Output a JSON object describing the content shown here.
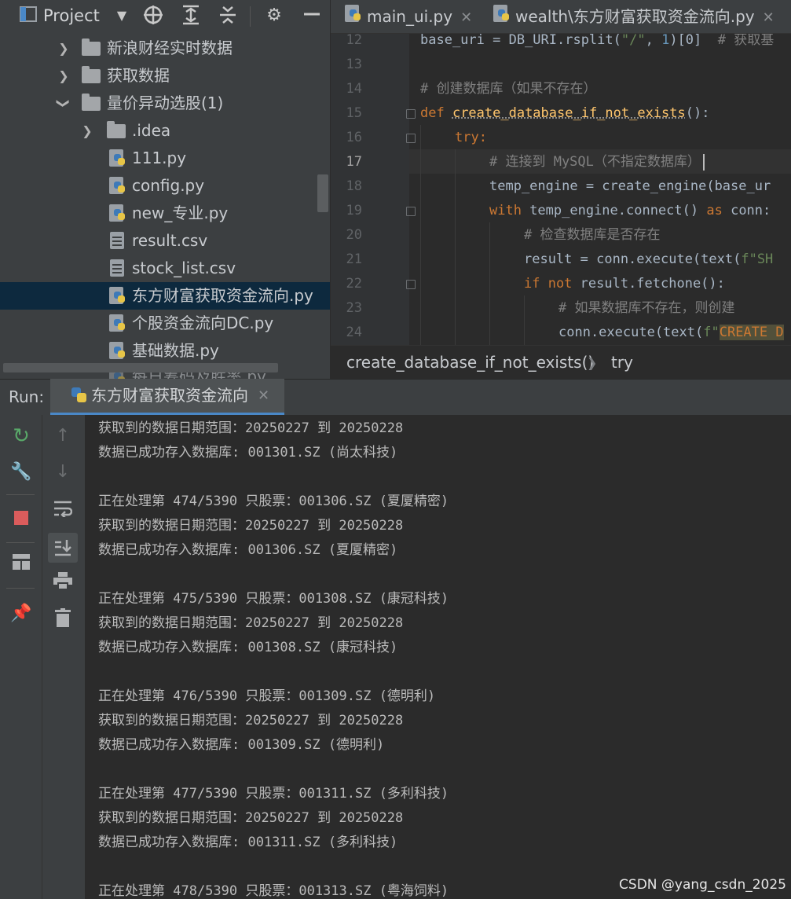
{
  "project_panel": {
    "title": "Project",
    "tree": [
      {
        "label": "新浪财经实时数据",
        "kind": "folder",
        "expanded": false
      },
      {
        "label": "获取数据",
        "kind": "folder",
        "expanded": false
      },
      {
        "label": "量价异动选股(1)",
        "kind": "folder",
        "expanded": true
      },
      {
        "label": ".idea",
        "kind": "folder",
        "expanded": false
      },
      {
        "label": "111.py",
        "kind": "python-file"
      },
      {
        "label": "config.py",
        "kind": "python-file"
      },
      {
        "label": "new_专业.py",
        "kind": "python-file"
      },
      {
        "label": "result.csv",
        "kind": "csv-file"
      },
      {
        "label": "stock_list.csv",
        "kind": "csv-file"
      },
      {
        "label": "东方财富获取资金流向.py",
        "kind": "python-file",
        "selected": true
      },
      {
        "label": "个股资金流向DC.py",
        "kind": "python-file"
      },
      {
        "label": "基础数据.py",
        "kind": "python-file"
      },
      {
        "label": "每日筹码及胜率.py",
        "kind": "python-file"
      }
    ]
  },
  "editor": {
    "tabs": [
      {
        "label": "main_ui.py"
      },
      {
        "label": "wealth\\东方财富获取资金流向.py"
      }
    ],
    "line_numbers": [
      "12",
      "13",
      "14",
      "15",
      "16",
      "17",
      "18",
      "19",
      "20",
      "21",
      "22",
      "23",
      "24"
    ],
    "lines": {
      "l12a": "base_uri = DB_URI.rsplit(",
      "l12b": "\"/\"",
      "l12c": ", ",
      "l12d": "1",
      "l12e": ")[0]  ",
      "l12f": "# 获取基",
      "l14": "# 创建数据库（如果不存在）",
      "l15a": "def ",
      "l15b": "create_database_if_not_exists",
      "l15c": "():",
      "l16": "try:",
      "l17": "# 连接到 MySQL（不指定数据库）",
      "l18": "temp_engine = create_engine(base_ur",
      "l19a": "with ",
      "l19b": "temp_engine.connect() ",
      "l19c": "as ",
      "l19d": "conn:",
      "l20": "# 检查数据库是否存在",
      "l21a": "result = conn.execute(text(",
      "l21b": "f\"SH",
      "l22a": "if not ",
      "l22b": "result.fetchone():",
      "l23": "# 如果数据库不存在，则创建",
      "l24a": "conn.execute(text(",
      "l24b": "f\"",
      "l24c": "CREATE D"
    },
    "breadcrumb": [
      "create_database_if_not_exists()",
      "try"
    ]
  },
  "run_panel": {
    "label": "Run:",
    "tab_label": "东方财富获取资金流向",
    "console": [
      "获取到的数据日期范围：20250227 到 20250228",
      "数据已成功存入数据库: 001301.SZ (尚太科技)",
      "",
      "正在处理第 474/5390 只股票：001306.SZ (夏厦精密)",
      "获取到的数据日期范围：20250227 到 20250228",
      "数据已成功存入数据库: 001306.SZ (夏厦精密)",
      "",
      "正在处理第 475/5390 只股票：001308.SZ (康冠科技)",
      "获取到的数据日期范围：20250227 到 20250228",
      "数据已成功存入数据库: 001308.SZ (康冠科技)",
      "",
      "正在处理第 476/5390 只股票：001309.SZ (德明利)",
      "获取到的数据日期范围：20250227 到 20250228",
      "数据已成功存入数据库: 001309.SZ (德明利)",
      "",
      "正在处理第 477/5390 只股票：001311.SZ (多利科技)",
      "获取到的数据日期范围：20250227 到 20250228",
      "数据已成功存入数据库: 001311.SZ (多利科技)",
      "",
      "正在处理第 478/5390 只股票：001313.SZ (粤海饲料)"
    ]
  },
  "watermark": "CSDN @yang_csdn_2025",
  "colors": {
    "accent": "#4a88c7",
    "keyword": "#cc7832",
    "function": "#ffc66d",
    "comment": "#808080",
    "string": "#6a8759",
    "number": "#6897bb",
    "selection": "#0d293e"
  }
}
